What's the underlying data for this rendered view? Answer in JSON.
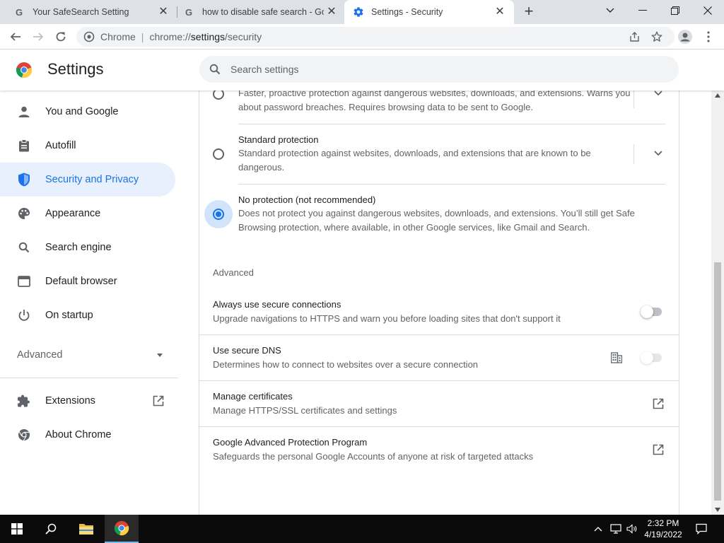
{
  "tabs": [
    {
      "title": "Your SafeSearch Setting",
      "icon": "google-g-icon"
    },
    {
      "title": "how to disable safe search - Goo",
      "icon": "google-g-icon"
    },
    {
      "title": "Settings - Security",
      "icon": "settings-gear-icon",
      "active": true
    }
  ],
  "omnibox": {
    "site": "Chrome",
    "divider": "|",
    "url_scheme": "chrome://",
    "url_host": "settings",
    "url_path": "/security"
  },
  "header": {
    "title": "Settings",
    "search_placeholder": "Search settings"
  },
  "sidebar": {
    "items": [
      {
        "label": "You and Google",
        "icon": "person-icon"
      },
      {
        "label": "Autofill",
        "icon": "clipboard-icon"
      },
      {
        "label": "Security and Privacy",
        "icon": "shield-icon",
        "selected": true
      },
      {
        "label": "Appearance",
        "icon": "palette-icon"
      },
      {
        "label": "Search engine",
        "icon": "search-icon"
      },
      {
        "label": "Default browser",
        "icon": "browser-window-icon"
      },
      {
        "label": "On startup",
        "icon": "power-icon"
      }
    ],
    "advanced_label": "Advanced",
    "extensions_label": "Extensions",
    "about_label": "About Chrome"
  },
  "protection": {
    "enhanced": {
      "desc": "Faster, proactive protection against dangerous websites, downloads, and extensions. Warns you about password breaches. Requires browsing data to be sent to Google."
    },
    "standard": {
      "title": "Standard protection",
      "desc": "Standard protection against websites, downloads, and extensions that are known to be dangerous."
    },
    "none": {
      "title": "No protection (not recommended)",
      "desc": "Does not protect you against dangerous websites, downloads, and extensions. You’ll still get Safe Browsing protection, where available, in other Google services, like Gmail and Search.",
      "selected": true
    }
  },
  "advanced": {
    "section_title": "Advanced",
    "rows": [
      {
        "title": "Always use secure connections",
        "desc": "Upgrade navigations to HTTPS and warn you before loading sites that don't support it",
        "control": "toggle",
        "on": false
      },
      {
        "title": "Use secure DNS",
        "desc": "Determines how to connect to websites over a secure connection",
        "control": "toggle",
        "on": false,
        "managed": true
      },
      {
        "title": "Manage certificates",
        "desc": "Manage HTTPS/SSL certificates and settings",
        "control": "external-link"
      },
      {
        "title": "Google Advanced Protection Program",
        "desc": "Safeguards the personal Google Accounts of anyone at risk of targeted attacks",
        "control": "external-link"
      }
    ]
  },
  "taskbar": {
    "time": "2:32 PM",
    "date": "4/19/2022"
  },
  "colors": {
    "accent": "#1a73e8",
    "selected_nav_bg": "#e8f0fe",
    "tabstrip": "#dee1e6",
    "taskbar": "#0b0b0b"
  }
}
